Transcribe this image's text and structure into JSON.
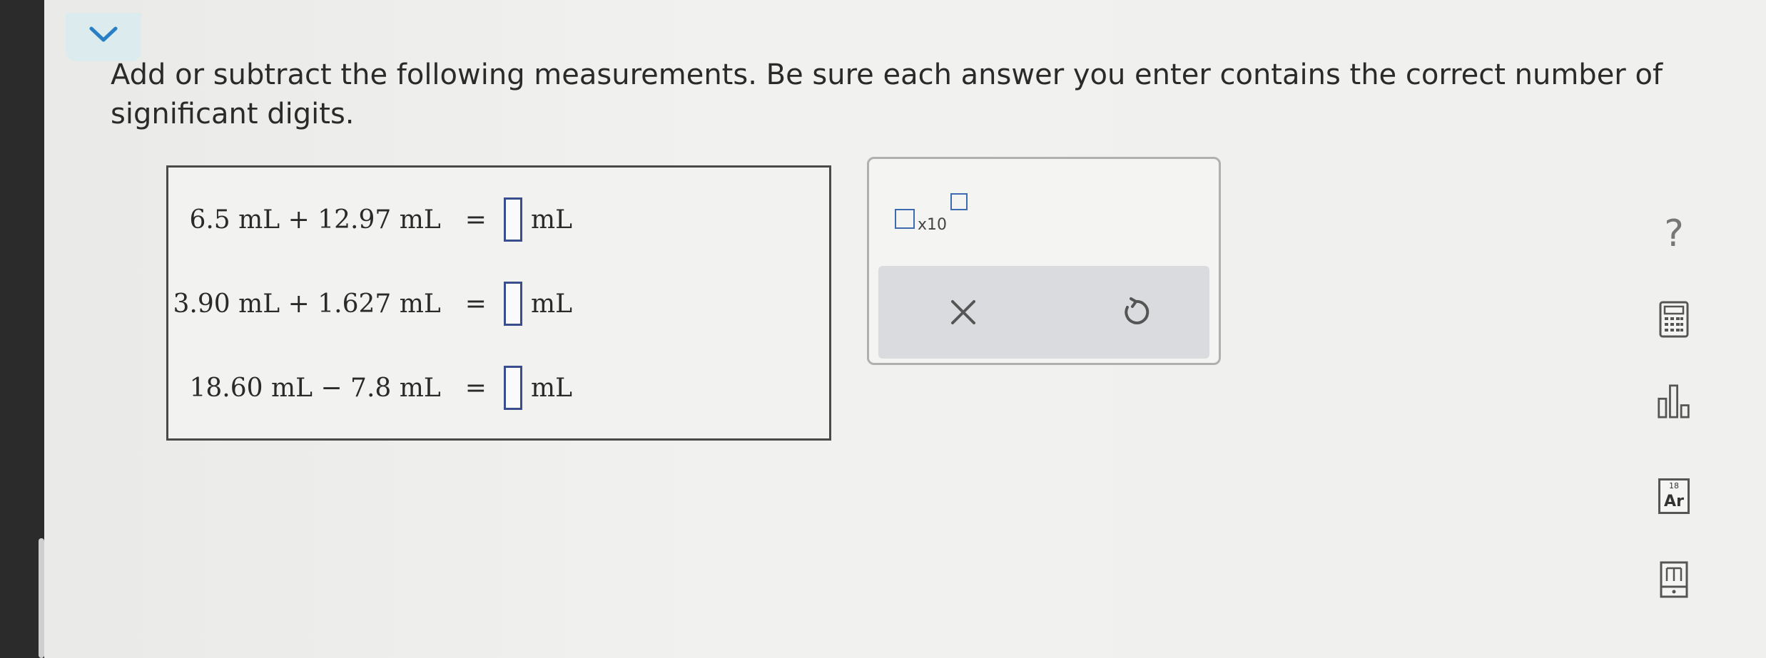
{
  "prompt": {
    "text": "Add or subtract the following measurements. Be sure each answer you enter contains the correct number of significant digits."
  },
  "equations": [
    {
      "lhs": "6.5 mL + 12.97 mL",
      "eq": "=",
      "answer": "",
      "unit": "mL"
    },
    {
      "lhs": "3.90 mL + 1.627 mL",
      "eq": "=",
      "answer": "",
      "unit": "mL"
    },
    {
      "lhs": "18.60 mL − 7.8 mL",
      "eq": "=",
      "answer": "",
      "unit": "mL"
    }
  ],
  "tool_panel": {
    "sci_notation_label": "x10",
    "clear_icon": "x-icon",
    "undo_icon": "undo-icon"
  },
  "sidebar": {
    "help_label": "?",
    "calculator_icon": "calculator-icon",
    "data_icon": "bar-chart-icon",
    "periodic_table": {
      "number": "18",
      "symbol": "Ar"
    },
    "reference_icon": "book-icon"
  },
  "colors": {
    "accent": "#3e6bb0",
    "tab_bg": "#dcebee",
    "chevron": "#2a7fc4"
  }
}
